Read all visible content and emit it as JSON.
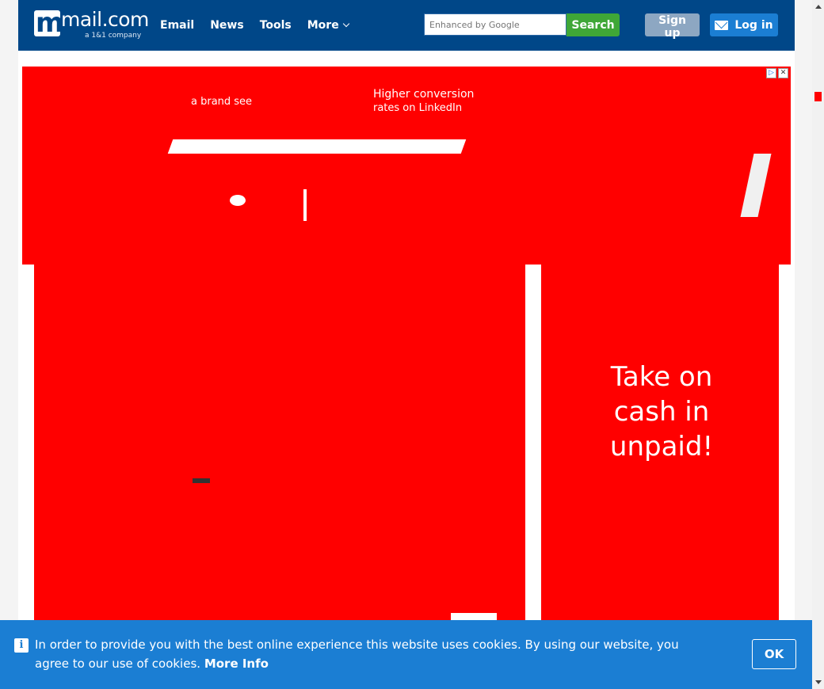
{
  "header": {
    "logo_word": "mail.com",
    "logo_sub": "a 1&1 company",
    "nav": [
      "Email",
      "News",
      "Tools",
      "More"
    ],
    "search": {
      "placeholder": "Enhanced by Google",
      "button": "Search"
    },
    "signup": "Sign up",
    "login": "Log in"
  },
  "ads": {
    "banner_texts": [
      "a brand see",
      "Higher conversion",
      "rates on LinkedIn"
    ],
    "side_texts": [
      "Take on",
      "cash in",
      "unpaid!"
    ]
  },
  "cookie": {
    "message": "In order to provide you with the best online experience this website uses cookies. By using our website, you agree to our use of cookies. ",
    "more_info": "More Info",
    "ok": "OK"
  },
  "colors": {
    "brand": "#004788",
    "ad": "#ff0000",
    "cookie": "#1b7ed3",
    "search": "#3fa737"
  }
}
